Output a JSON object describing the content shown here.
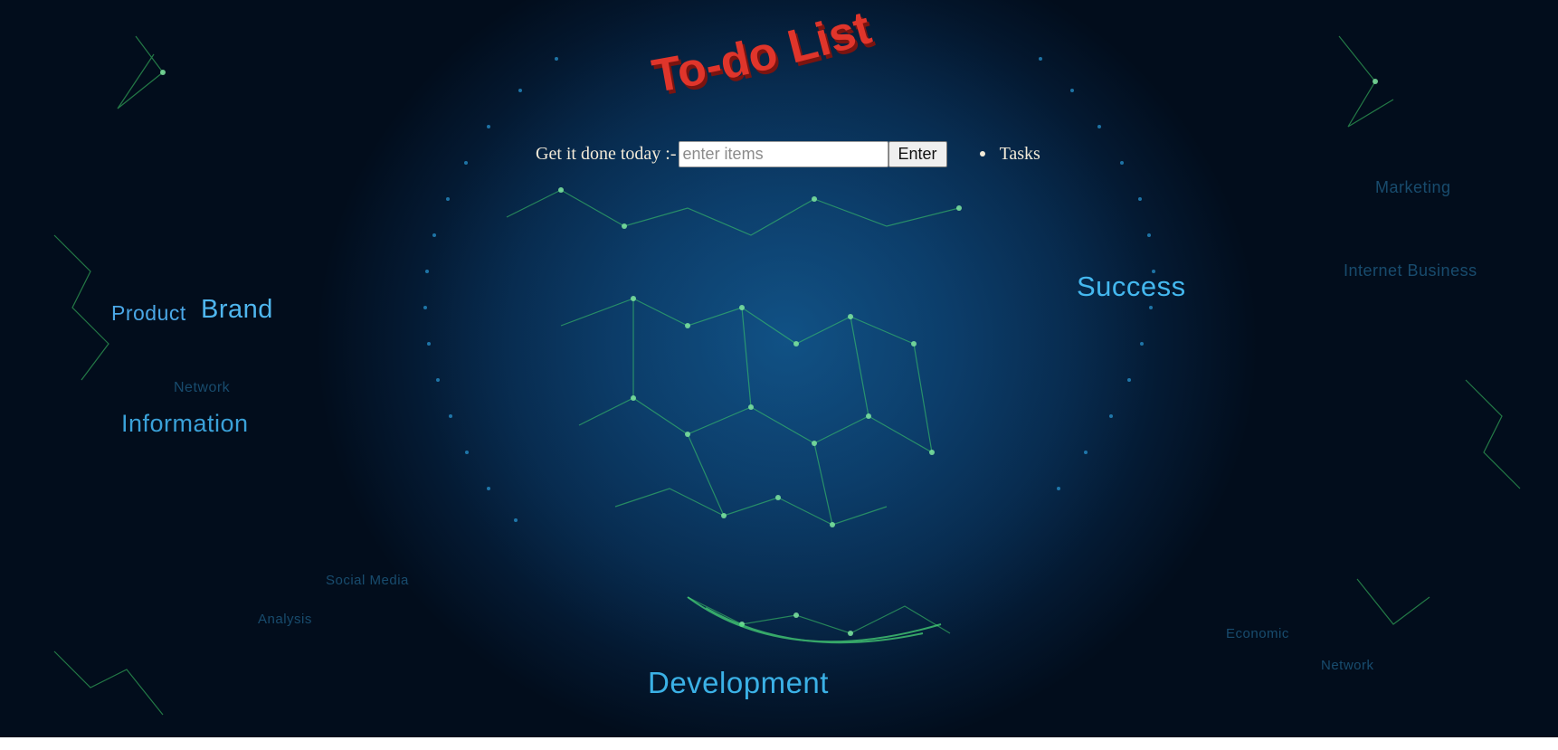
{
  "header": {
    "title": "To-do List"
  },
  "form": {
    "prompt_label": "Get it done today :-",
    "input_placeholder": "enter items",
    "input_value": "",
    "enter_label": "Enter"
  },
  "tasks": [
    {
      "label": "Tasks"
    }
  ],
  "background_words": {
    "brand": "Brand",
    "product": "Product",
    "information": "Information",
    "network": "Network",
    "success": "Success",
    "development": "Development",
    "marketing": "Marketing",
    "internet_business": "Internet Business",
    "social_media": "Social Media",
    "analysis": "Analysis",
    "economic": "Economic",
    "research": "Network"
  },
  "colors": {
    "title_red": "#e0352b",
    "text_cream": "#f2ead8",
    "background_blue": "#0b3a66",
    "network_green": "#3fd36a",
    "network_cyan": "#3fb4ea"
  },
  "icons": {
    "task_bullet": "bullet-dot-icon"
  }
}
